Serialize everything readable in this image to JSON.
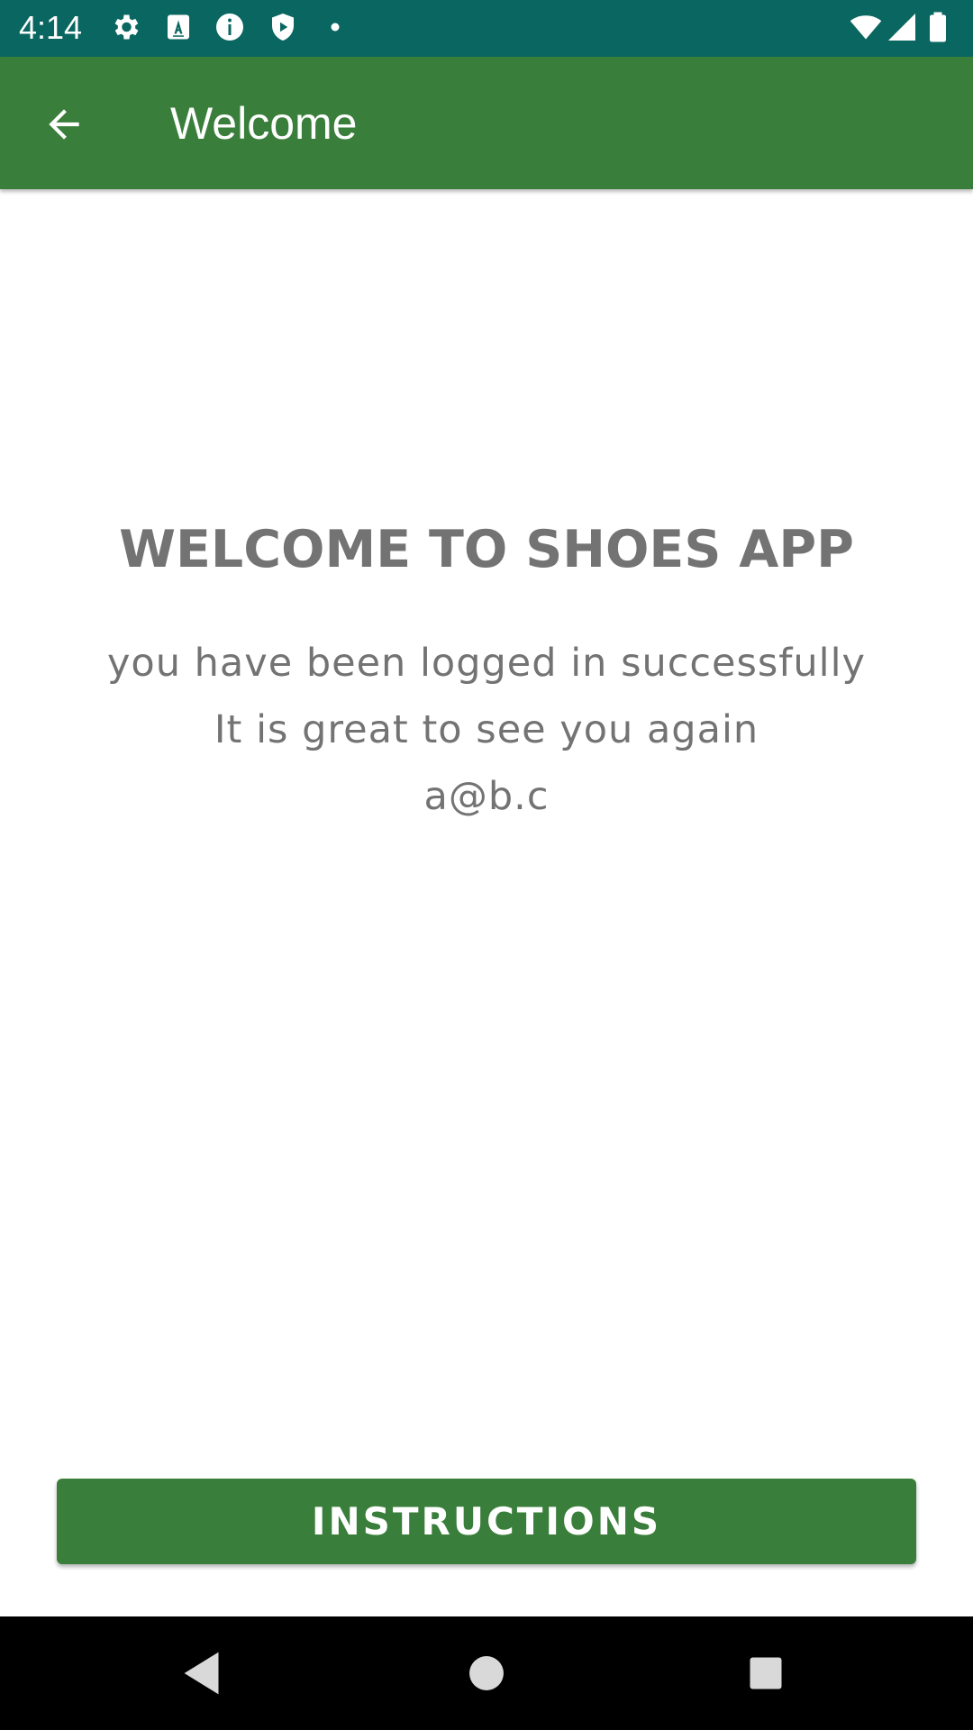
{
  "status_bar": {
    "time": "4:14",
    "icons": [
      "settings-icon",
      "font-a-icon",
      "info-icon",
      "shield-play-icon",
      "dot-icon"
    ],
    "right_icons": [
      "wifi-icon",
      "signal-icon",
      "battery-icon"
    ]
  },
  "app_bar": {
    "back_icon": "arrow-left-icon",
    "title": "Welcome"
  },
  "content": {
    "heading": "WELCOME TO SHOES APP",
    "line1": "you have been logged in successfully",
    "line2": "It is great to see you again",
    "email": "a@b.c"
  },
  "buttons": {
    "instructions_label": "INSTRUCTIONS"
  },
  "nav_bar": {
    "icons": [
      "back-triangle-icon",
      "home-circle-icon",
      "recents-square-icon"
    ]
  },
  "colors": {
    "status_bar": "#0a6660",
    "primary": "#3a7e3b",
    "text_gray": "#737373"
  }
}
